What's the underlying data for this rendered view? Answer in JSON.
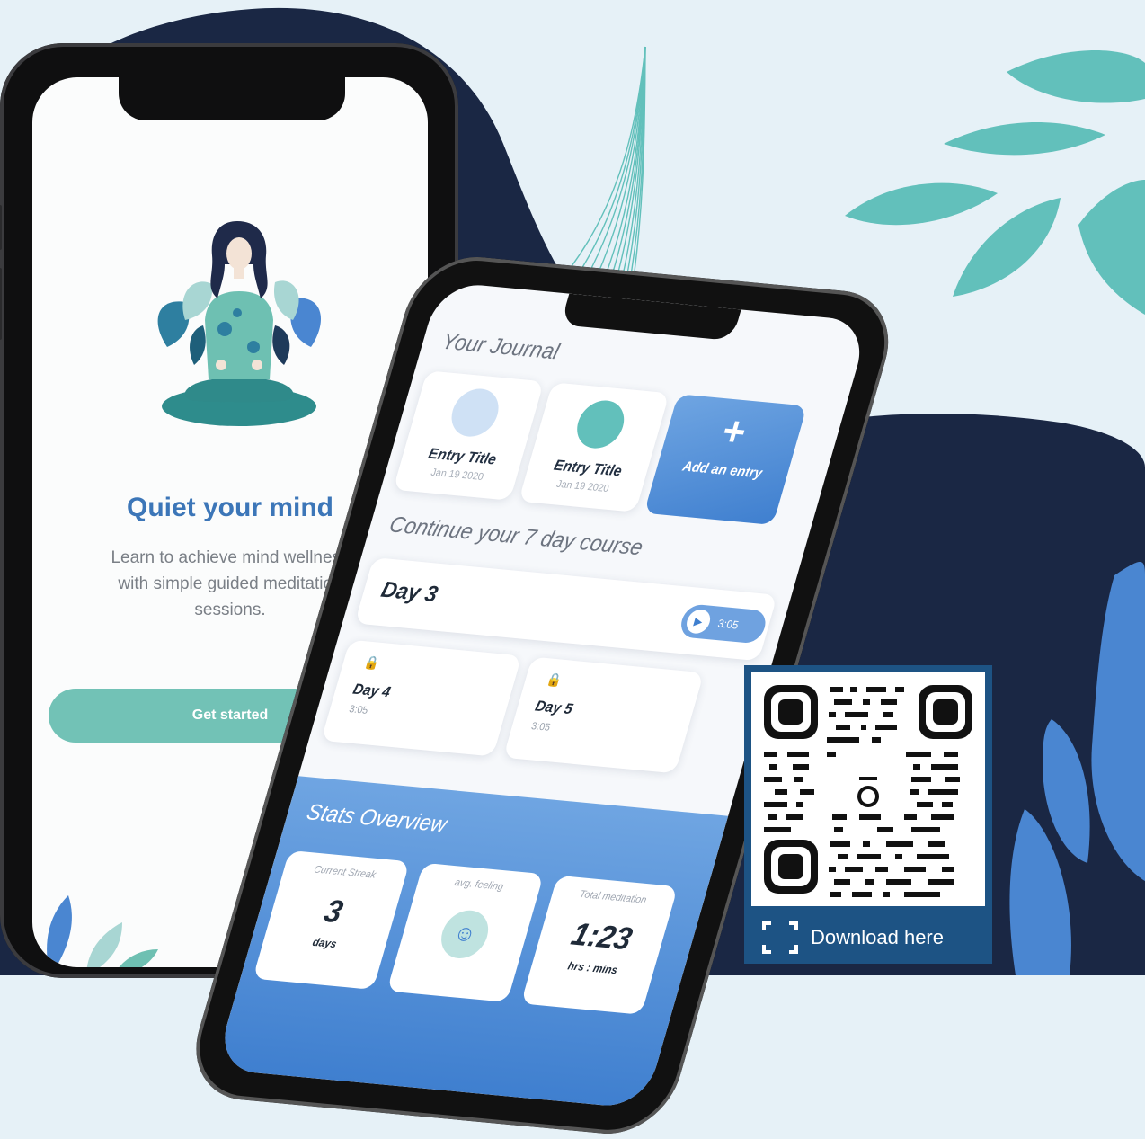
{
  "colors": {
    "background": "#e6f1f7",
    "navy_blob": "#1a2744",
    "teal_leaf": "#62c0bb",
    "blue_leaf": "#4a86d1",
    "accent_blue": "#3c76b8",
    "button_teal": "#72c2b6"
  },
  "onboarding": {
    "title": "Quiet your mind",
    "description": "Learn to achieve mind wellness with simple guided meditation sessions.",
    "cta": "Get started",
    "illustration": "meditation-woman-illustration"
  },
  "journal": {
    "heading": "Your Journal",
    "entries": [
      {
        "title": "Entry Title",
        "date": "Jan 19 2020",
        "mood": "neutral-face-icon"
      },
      {
        "title": "Entry Title",
        "date": "Jan 19 2020",
        "mood": "happy-face-icon"
      }
    ],
    "add_label": "Add an entry",
    "add_icon": "+"
  },
  "course": {
    "heading": "Continue your 7 day course",
    "current_day": "Day 3",
    "current_duration": "3:05",
    "locked": [
      {
        "label": "Day 4",
        "duration": "3:05"
      },
      {
        "label": "Day 5",
        "duration": "3:05"
      }
    ]
  },
  "stats": {
    "heading": "Stats Overview",
    "streak": {
      "label": "Current Streak",
      "value": "3",
      "unit": "days"
    },
    "feeling": {
      "label": "avg. feeling",
      "icon": "smiley-face-icon"
    },
    "total": {
      "label": "Total meditation",
      "value": "1:23",
      "unit": "hrs : mins"
    }
  },
  "qr": {
    "download_label": "Download here",
    "scan_icon": "scan-frame-icon"
  }
}
